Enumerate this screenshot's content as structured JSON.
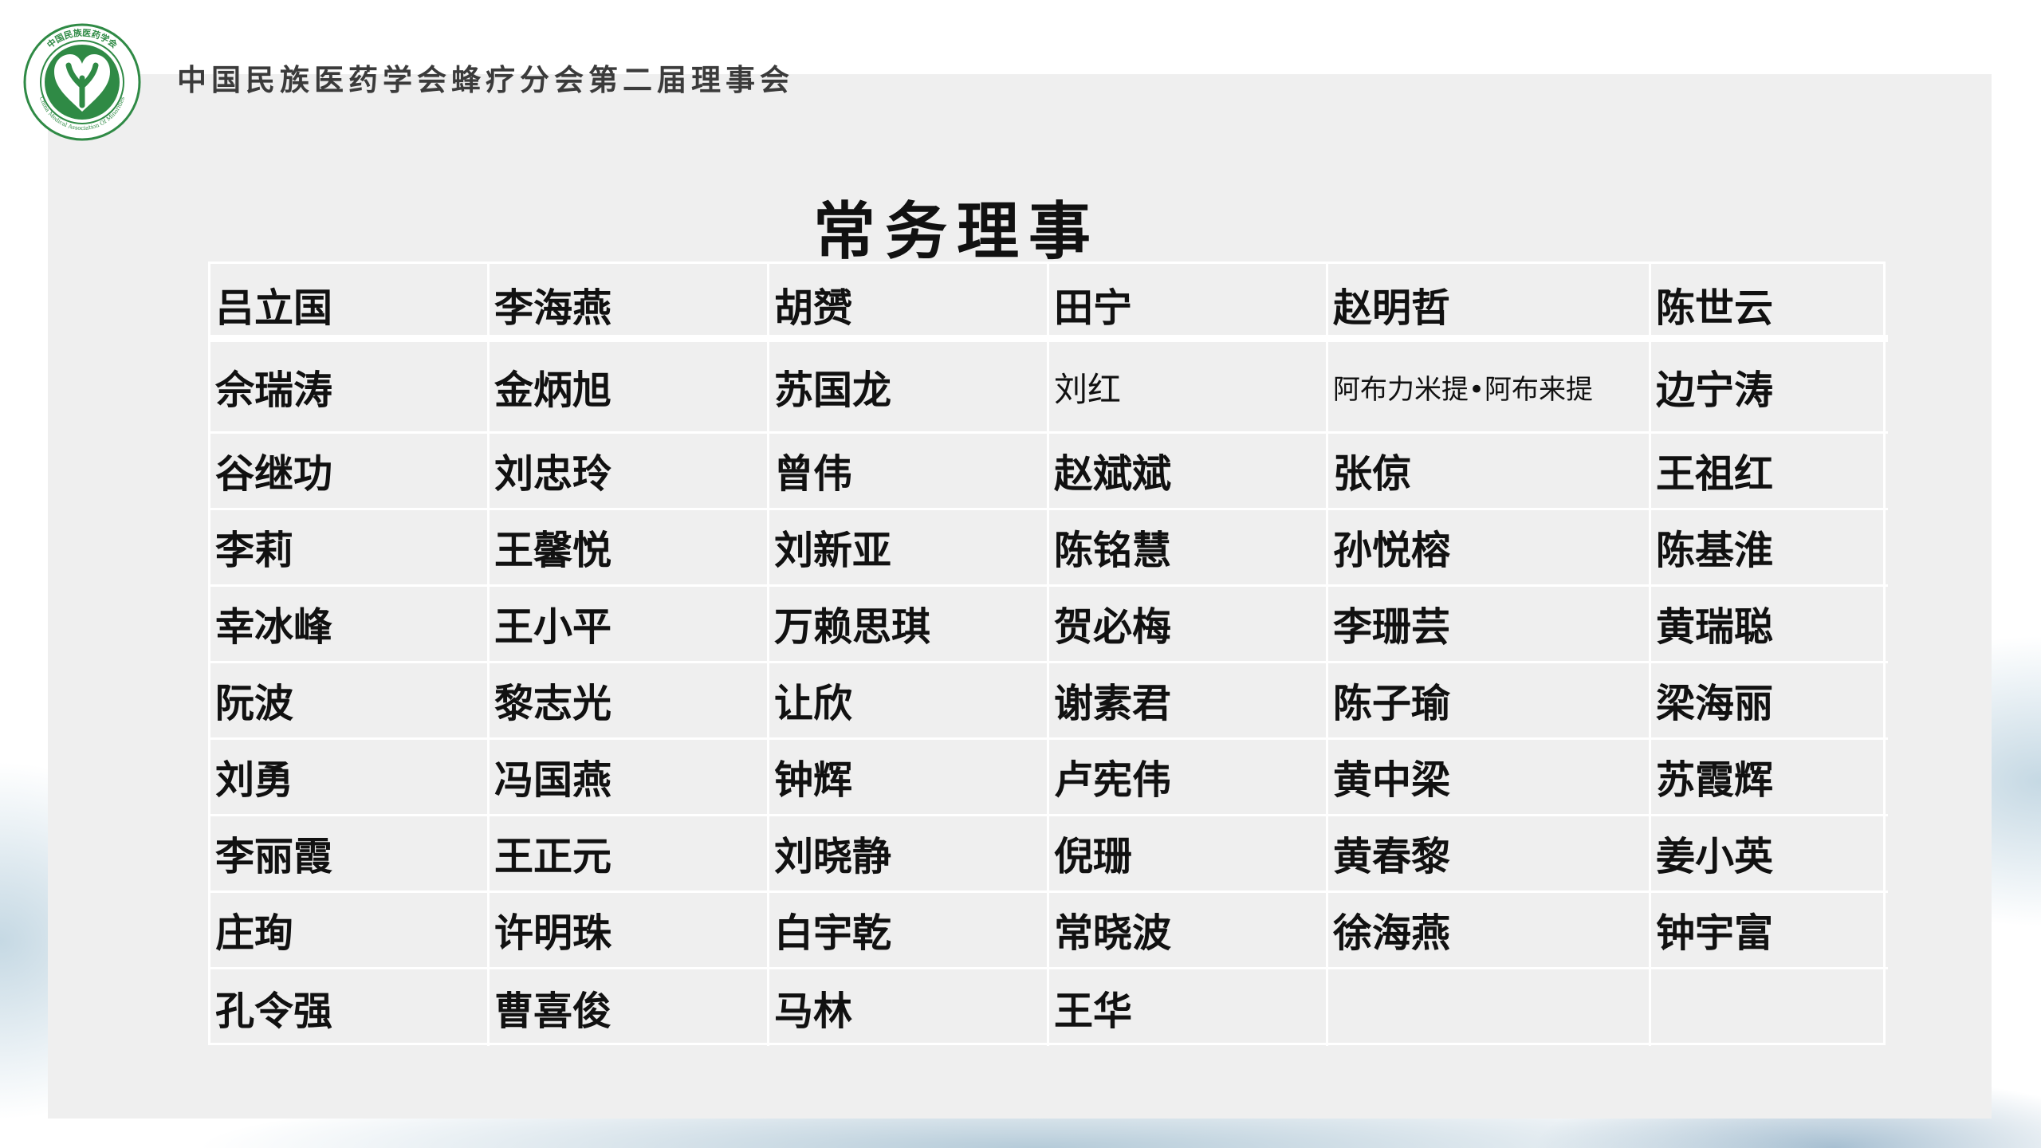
{
  "header": {
    "organization": "中国民族医药学会蜂疗分会第二届理事会",
    "logo_text": "中国民族医药学会",
    "logo_subtext": "China Medical Association Of Minorities"
  },
  "page_title": "常务理事",
  "members": [
    [
      "吕立国",
      "李海燕",
      "胡赟",
      "田宁",
      "赵明哲",
      "陈世云"
    ],
    [
      "佘瑞涛",
      "金炳旭",
      "苏国龙",
      "刘红",
      "阿布力米提•阿布来提",
      "边宁涛"
    ],
    [
      "谷继功",
      "刘忠玲",
      "曾伟",
      "赵斌斌",
      "张倞",
      "王祖红"
    ],
    [
      "李莉",
      "王馨悦",
      "刘新亚",
      "陈铭慧",
      "孙悦榕",
      "陈基淮"
    ],
    [
      "幸冰峰",
      "王小平",
      "万赖思琪",
      "贺必梅",
      "李珊芸",
      "黄瑞聪"
    ],
    [
      "阮波",
      "黎志光",
      "让欣",
      "谢素君",
      "陈子瑜",
      "梁海丽"
    ],
    [
      "刘勇",
      "冯国燕",
      "钟辉",
      "卢宪伟",
      "黄中梁",
      "苏霞辉"
    ],
    [
      "李丽霞",
      "王正元",
      "刘晓静",
      "倪珊",
      "黄春黎",
      "姜小英"
    ],
    [
      "庄珣",
      "许明珠",
      "白宇乾",
      "常晓波",
      "徐海燕",
      "钟宇富"
    ],
    [
      "孔令强",
      "曹喜俊",
      "马林",
      "王华",
      "",
      ""
    ]
  ],
  "colors": {
    "logo_green": "#2f8a45",
    "panel": "#efefef",
    "grid_line": "#ffffff"
  }
}
